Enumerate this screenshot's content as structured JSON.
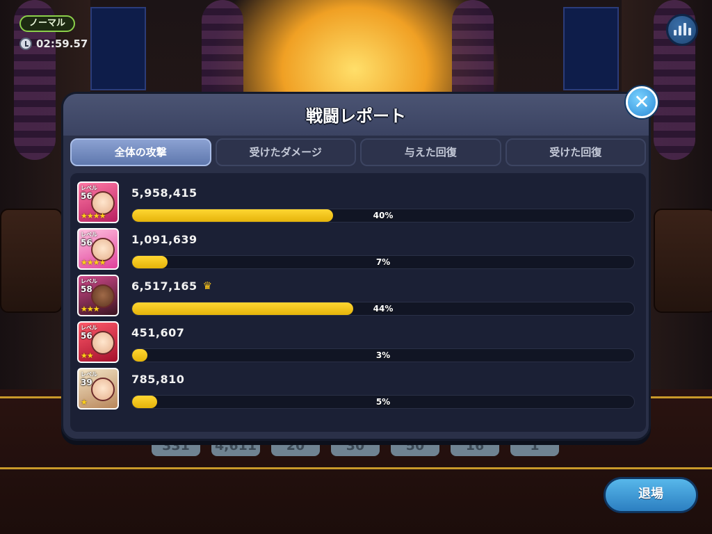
{
  "hud": {
    "mode": "ノーマル",
    "timer": "02:59.57"
  },
  "modal": {
    "title": "戦闘レポート",
    "tabs": [
      {
        "label": "全体の攻撃",
        "active": true
      },
      {
        "label": "受けたダメージ",
        "active": false
      },
      {
        "label": "与えた回復",
        "active": false
      },
      {
        "label": "受けた回復",
        "active": false
      }
    ],
    "level_caption": "レベル",
    "rows": [
      {
        "level": "56",
        "stars": "★★★★",
        "score": "5,958,415",
        "percent": 40,
        "percent_label": "40%",
        "crown": ""
      },
      {
        "level": "56",
        "stars": "★★★★",
        "score": "1,091,639",
        "percent": 7,
        "percent_label": "7%",
        "crown": ""
      },
      {
        "level": "58",
        "stars": "★★★",
        "score": "6,517,165",
        "percent": 44,
        "percent_label": "44%",
        "crown": "♛"
      },
      {
        "level": "56",
        "stars": "★★",
        "score": "451,607",
        "percent": 3,
        "percent_label": "3%",
        "crown": ""
      },
      {
        "level": "39",
        "stars": "★",
        "score": "785,810",
        "percent": 5,
        "percent_label": "5%",
        "crown": ""
      }
    ]
  },
  "background_stats": [
    "331",
    "4,611",
    "20",
    "30",
    "50",
    "16",
    "1"
  ],
  "exit_label": "退場",
  "icons": {
    "close": "close-icon",
    "stats": "bar-chart-icon",
    "clock": "clock-icon",
    "crown": "crown-icon"
  },
  "colors": {
    "bar_fill": "#ffd632",
    "modal_bg": "#2a3048",
    "active_tab": "#8ba1d2",
    "exit_button": "#2c7fc1"
  }
}
